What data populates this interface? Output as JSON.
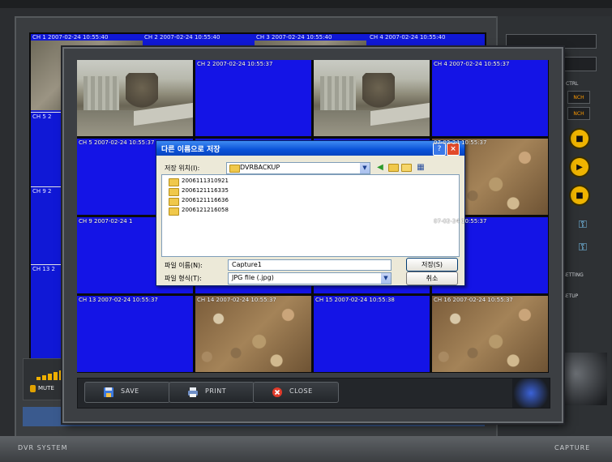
{
  "background_window": {
    "channel_labels": [
      "CH 1 2007-02-24 10:55:40",
      "CH 2 2007-02-24 10:55:40",
      "CH 3 2007-02-24 10:55:40",
      "CH 4 2007-02-24 10:55:40"
    ],
    "left_labels": [
      "CH 5 2",
      "CH 9 2",
      "CH 13 2"
    ],
    "status": {
      "mute_label": "MUTE"
    },
    "bottom_left_label": "DVR SYSTEM",
    "bottom_right_label": "CAPTURE"
  },
  "side_panel": {
    "small_buttons": [
      "NCH",
      "NCH"
    ],
    "labels": [
      "CTRL",
      "SETTING",
      "SETUP"
    ]
  },
  "capture_window": {
    "cells": [
      {
        "label": "",
        "view": "building"
      },
      {
        "label": "CH 2 2007-02-24 10:55:37",
        "view": "empty"
      },
      {
        "label": "",
        "view": "building"
      },
      {
        "label": "CH 4 2007-02-24 10:55:37",
        "view": "empty"
      },
      {
        "label": "CH 5 2007-02-24 10:55:37",
        "view": "empty"
      },
      {
        "label": "",
        "view": "empty"
      },
      {
        "label": "",
        "view": "empty"
      },
      {
        "label": "07-02-24 10:55:37",
        "view": "rocks"
      },
      {
        "label": "CH 9 2007-02-24 1",
        "view": "empty"
      },
      {
        "label": "",
        "view": "empty"
      },
      {
        "label": "",
        "view": "empty"
      },
      {
        "label": "07-02-24 10:55:37",
        "view": "empty"
      },
      {
        "label": "CH 13 2007-02-24 10:55:37",
        "view": "empty"
      },
      {
        "label": "CH 14 2007-02-24 10:55:37",
        "view": "rocks"
      },
      {
        "label": "CH 15 2007-02-24 10:55:38",
        "view": "empty"
      },
      {
        "label": "CH 16 2007-02-24 10:55:37",
        "view": "rocks"
      }
    ],
    "toolbar": {
      "save_label": "SAVE",
      "print_label": "PRINT",
      "close_label": "CLOSE"
    }
  },
  "save_dialog": {
    "title": "다른 이름으로 저장",
    "save_in_label": "저장 위치(I):",
    "save_in_value": "DVRBACKUP",
    "files": [
      "2006111310921",
      "2006121116335",
      "2006121116636",
      "2006121216058"
    ],
    "filename_label": "파일 이름(N):",
    "filename_value": "Capture1",
    "filetype_label": "파일 형식(T):",
    "filetype_value": "JPG file (.jpg)",
    "save_button": "저장(S)",
    "cancel_button": "취소"
  },
  "colors": {
    "channel_blue": "#1414e6",
    "accent_yellow": "#efb400",
    "dialog_titlebar": "#0a52d8"
  }
}
